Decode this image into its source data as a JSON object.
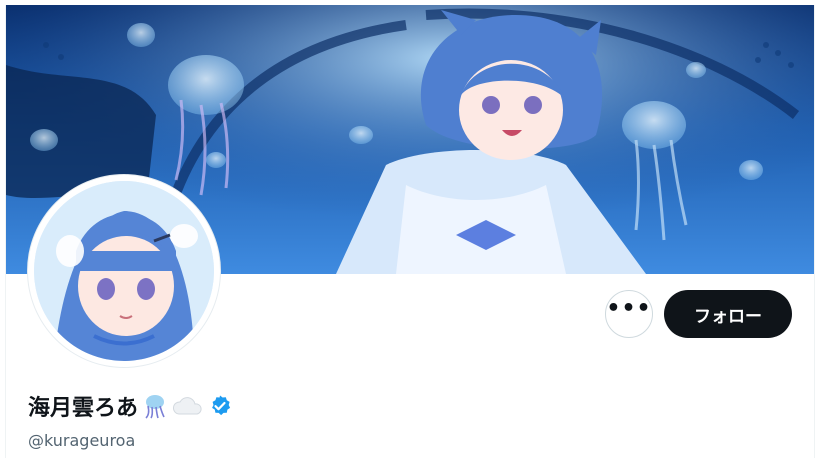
{
  "profile": {
    "display_name": "海月雲ろあ",
    "handle": "@kurageuroa",
    "name_emojis": [
      "jellyfish-emoji",
      "cloud-emoji"
    ],
    "verified": true
  },
  "actions": {
    "more_label": "•••",
    "follow_label": "フォロー"
  },
  "colors": {
    "follow_bg": "#0f1419",
    "verified_badge": "#1d9bf0",
    "handle_text": "#536471",
    "banner_deep": "#0a2f6e",
    "banner_light": "#3f8be0"
  }
}
